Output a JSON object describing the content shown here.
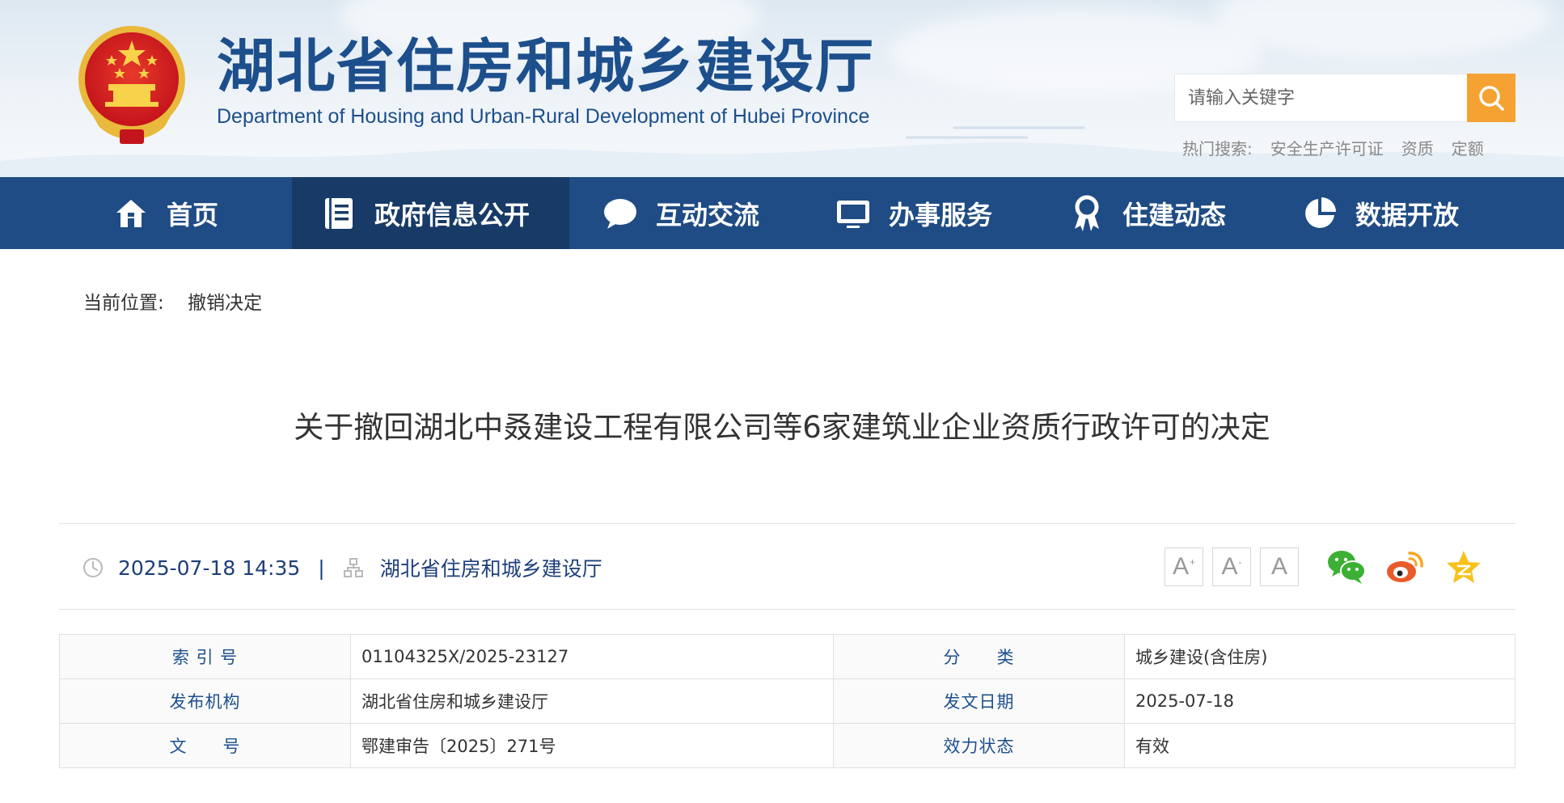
{
  "header": {
    "title": "湖北省住房和城乡建设厅",
    "subtitle": "Department of Housing and Urban-Rural Development of Hubei Province",
    "search": {
      "placeholder": "请输入关键字"
    },
    "hot_search": {
      "label": "热门搜索:",
      "keywords": [
        "安全生产许可证",
        "资质",
        "定额"
      ]
    }
  },
  "nav": {
    "items": [
      {
        "label": "首页",
        "icon": "home-icon"
      },
      {
        "label": "政府信息公开",
        "icon": "document-list-icon",
        "active": true
      },
      {
        "label": "互动交流",
        "icon": "chat-bubble-icon"
      },
      {
        "label": "办事服务",
        "icon": "monitor-icon"
      },
      {
        "label": "住建动态",
        "icon": "award-ribbon-icon"
      },
      {
        "label": "数据开放",
        "icon": "pie-chart-icon"
      }
    ]
  },
  "breadcrumb": {
    "label": "当前位置:",
    "current": "撤销决定"
  },
  "article": {
    "title": "关于撤回湖北中叒建设工程有限公司等6家建筑业企业资质行政许可的决定",
    "datetime": "2025-07-18 14:35",
    "separator": "|",
    "publisher": "湖北省住房和城乡建设厅"
  },
  "font_controls": {
    "increase": "A",
    "decrease": "A",
    "reset": "A",
    "plus": "+",
    "minus": "-"
  },
  "share": {
    "icons": [
      "wechat-icon",
      "weibo-icon",
      "qzone-icon"
    ]
  },
  "info": {
    "index_no_label": "索 引 号",
    "index_no": "01104325X/2025-23127",
    "category_label": "分　　类",
    "category": "城乡建设(含住房)",
    "issuer_label": "发布机构",
    "issuer": "湖北省住房和城乡建设厅",
    "issue_date_label": "发文日期",
    "issue_date": "2025-07-18",
    "doc_no_label": "文　　号",
    "doc_no": "鄂建审告〔2025〕271号",
    "status_label": "效力状态",
    "status": "有效"
  },
  "colors": {
    "nav_bg": "#1f4c84",
    "nav_active": "#173a66",
    "accent": "#f5a232",
    "title_blue": "#1d4f8c"
  }
}
